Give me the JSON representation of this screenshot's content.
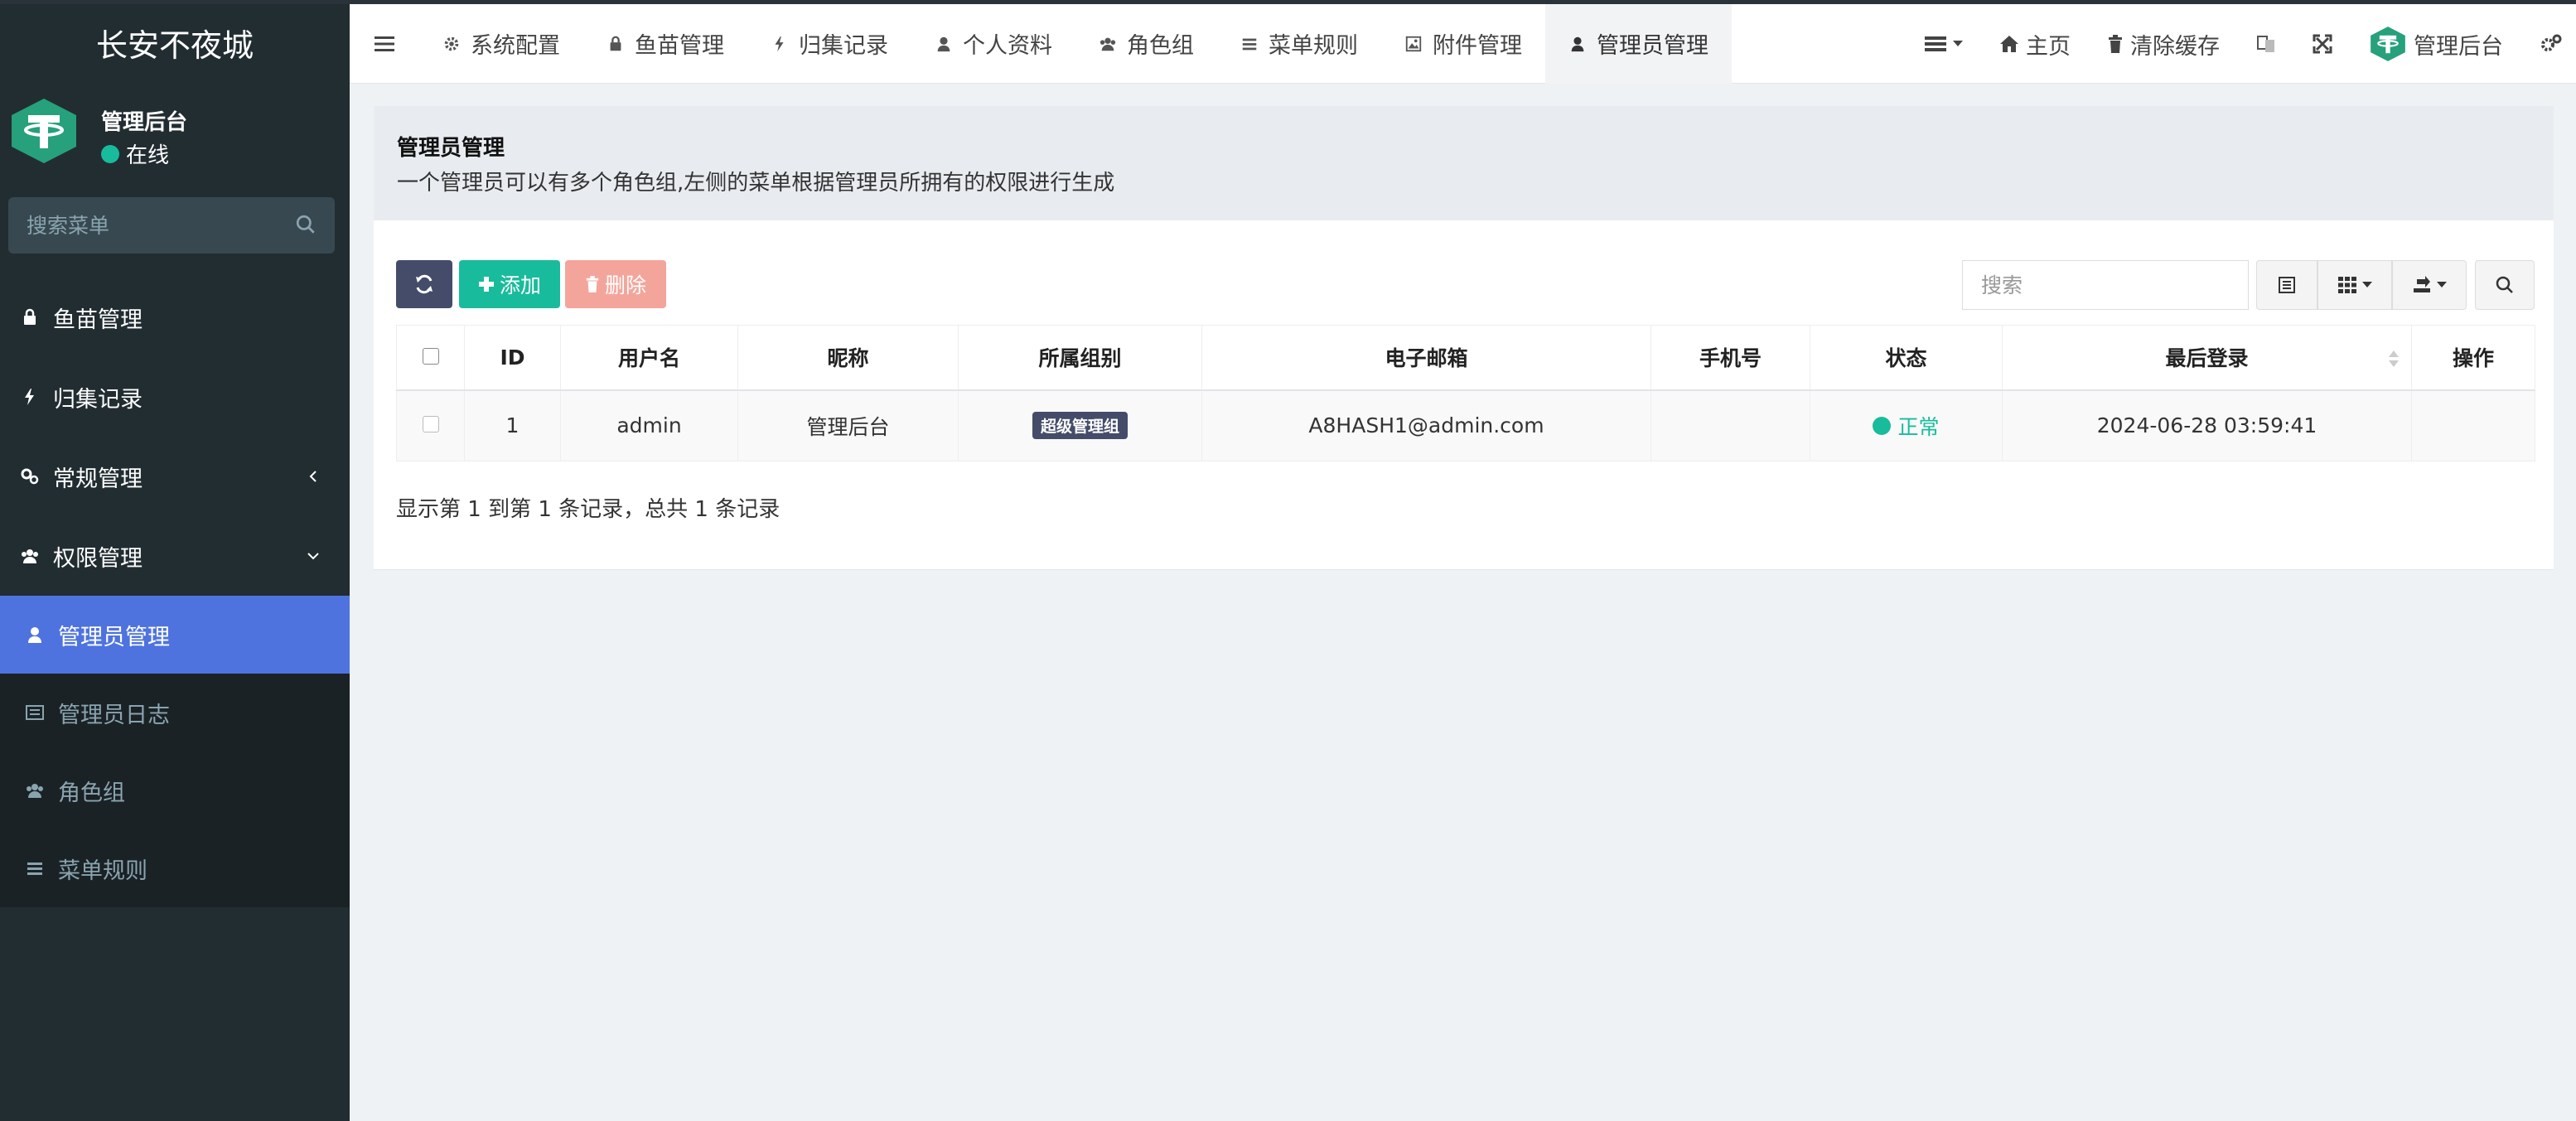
{
  "app": {
    "logo_text": "长安不夜城"
  },
  "user": {
    "name": "管理后台",
    "status": "在线"
  },
  "sidebar": {
    "search_placeholder": "搜索菜单",
    "items": [
      {
        "label": "鱼苗管理",
        "icon": "lock-icon"
      },
      {
        "label": "归集记录",
        "icon": "bolt-icon"
      },
      {
        "label": "常规管理",
        "icon": "cogs-icon"
      },
      {
        "label": "权限管理",
        "icon": "users-icon"
      }
    ],
    "subitems": [
      {
        "label": "管理员管理",
        "icon": "user-icon",
        "active": true
      },
      {
        "label": "管理员日志",
        "icon": "list-alt-icon"
      },
      {
        "label": "角色组",
        "icon": "group-icon"
      },
      {
        "label": "菜单规则",
        "icon": "bars-icon"
      }
    ]
  },
  "navbar": {
    "tabs": [
      {
        "label": "系统配置",
        "icon": "gear-icon"
      },
      {
        "label": "鱼苗管理",
        "icon": "lock-icon"
      },
      {
        "label": "归集记录",
        "icon": "bolt-icon"
      },
      {
        "label": "个人资料",
        "icon": "user-icon"
      },
      {
        "label": "角色组",
        "icon": "group-icon"
      },
      {
        "label": "菜单规则",
        "icon": "bars-icon"
      },
      {
        "label": "附件管理",
        "icon": "image-icon"
      },
      {
        "label": "管理员管理",
        "icon": "user-icon",
        "active": true
      }
    ],
    "right": {
      "home": "主页",
      "clear_cache": "清除缓存",
      "admin": "管理后台"
    }
  },
  "panel": {
    "title": "管理员管理",
    "description": "一个管理员可以有多个角色组,左侧的菜单根据管理员所拥有的权限进行生成"
  },
  "toolbar": {
    "add_label": "添加",
    "delete_label": "删除",
    "search_placeholder": "搜索"
  },
  "table": {
    "columns": [
      "ID",
      "用户名",
      "昵称",
      "所属组别",
      "电子邮箱",
      "手机号",
      "状态",
      "最后登录",
      "操作"
    ],
    "rows": [
      {
        "id": "1",
        "username": "admin",
        "nickname": "管理后台",
        "group": "超级管理组",
        "email": "A8HASH1@admin.com",
        "mobile": "",
        "status": "正常",
        "last_login": "2024-06-28 03:59:41",
        "operate": ""
      }
    ],
    "pagination_info": "显示第 1 到第 1 条记录，总共 1 条记录"
  },
  "colors": {
    "sidebar_bg": "#222d32",
    "active_blue": "#4e73df",
    "success": "#18bc9c",
    "danger_light": "#f4a59b",
    "dark_button": "#444c69"
  }
}
